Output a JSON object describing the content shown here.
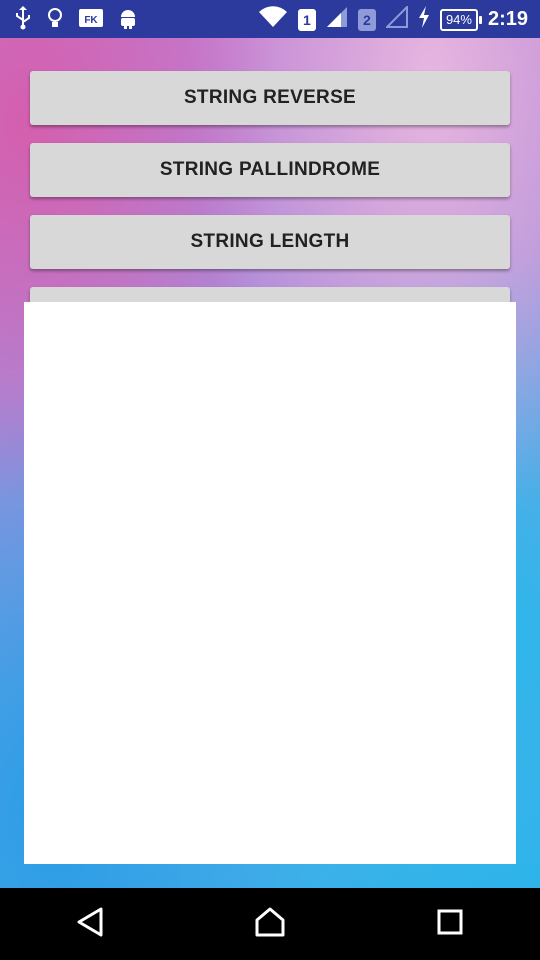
{
  "status_bar": {
    "time": "2:19",
    "battery": "94%",
    "sim1": "1",
    "sim2": "2",
    "left_icons": [
      "usb-icon",
      "lightbulb-icon",
      "fk-icon",
      "android-icon"
    ],
    "left_fk_label": "FK"
  },
  "buttons": [
    {
      "label": "STRING REVERSE"
    },
    {
      "label": "STRING PALLINDROME"
    },
    {
      "label": "STRING LENGTH"
    },
    {
      "label": ""
    }
  ],
  "nav": {
    "back": "back-icon",
    "home": "home-icon",
    "recents": "recents-icon"
  },
  "colors": {
    "status_bar": "#2b3a9c",
    "button_bg": "#d8d8d8",
    "button_text": "#222222"
  }
}
